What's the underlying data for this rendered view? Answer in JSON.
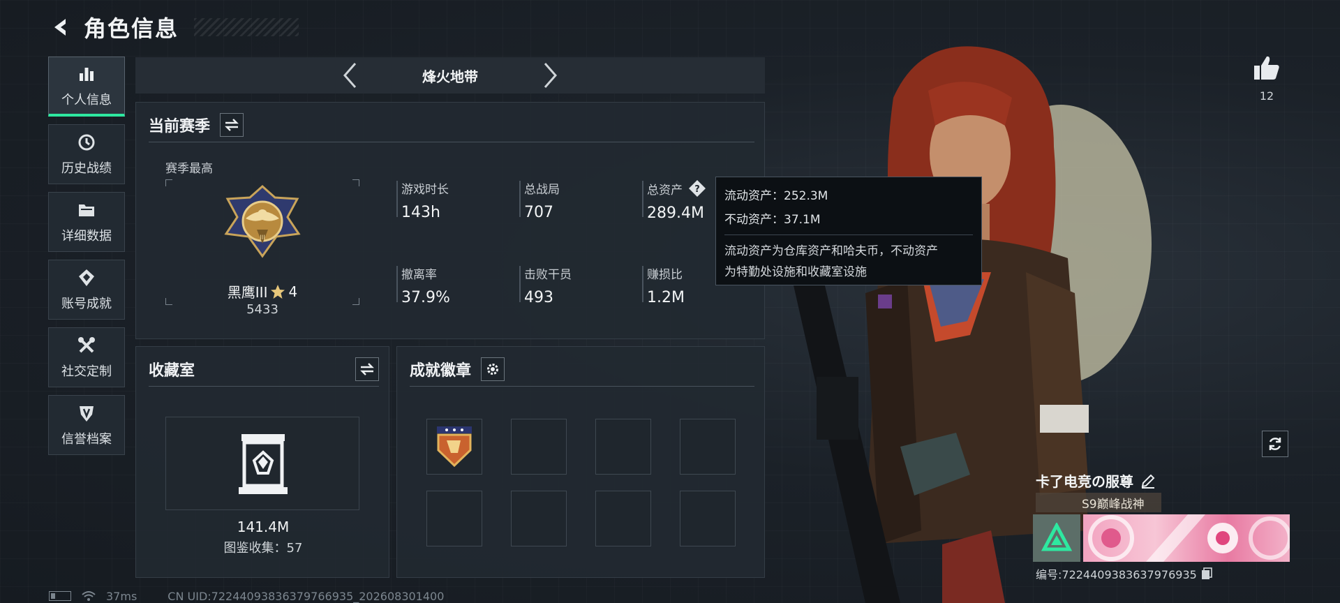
{
  "header": {
    "title": "角色信息",
    "back_icon": "chevron-left-icon"
  },
  "sidebar": {
    "items": [
      {
        "label": "个人信息",
        "icon": "bar-chart-icon",
        "active": true
      },
      {
        "label": "历史战绩",
        "icon": "history-icon",
        "active": false
      },
      {
        "label": "详细数据",
        "icon": "folder-icon",
        "active": false
      },
      {
        "label": "账号成就",
        "icon": "achievement-icon",
        "active": false
      },
      {
        "label": "社交定制",
        "icon": "tools-icon",
        "active": false
      },
      {
        "label": "信誉档案",
        "icon": "shield-icon",
        "active": false
      }
    ]
  },
  "mode_bar": {
    "title": "烽火地带"
  },
  "season": {
    "title": "当前赛季",
    "subtitle": "赛季最高",
    "rank_name": "黑鹰III",
    "rank_stars": "4",
    "rank_score": "5433",
    "stats": [
      {
        "label": "游戏时长",
        "value": "143h"
      },
      {
        "label": "总战局",
        "value": "707"
      },
      {
        "label": "总资产",
        "value": "289.4M"
      },
      {
        "label": "撤离率",
        "value": "37.9%"
      },
      {
        "label": "击败干员",
        "value": "493"
      },
      {
        "label": "赚损比",
        "value": "1.2M"
      }
    ]
  },
  "tooltip": {
    "liquid": "流动资产：252.3M",
    "fixed": "不动资产：37.1M",
    "desc_line1": "流动资产为仓库资产和哈夫币，不动资产",
    "desc_line2": "为特勤处设施和收藏室设施"
  },
  "collection": {
    "title": "收藏室",
    "value": "141.4M",
    "count": "图鉴收集：57"
  },
  "achievements": {
    "title": "成就徽章"
  },
  "right": {
    "like_count": "12",
    "player_name": "卡了电竞の服尊",
    "title_tag": "S9巅峰战神",
    "id_text": "编号:7224409383637976935"
  },
  "status_bar": {
    "ping": "37ms",
    "uid": "CN UID:72244093836379766935_202608301400"
  },
  "colors": {
    "accent": "#2ee8a0",
    "bg": "#1a2027",
    "panel": "#222931"
  }
}
